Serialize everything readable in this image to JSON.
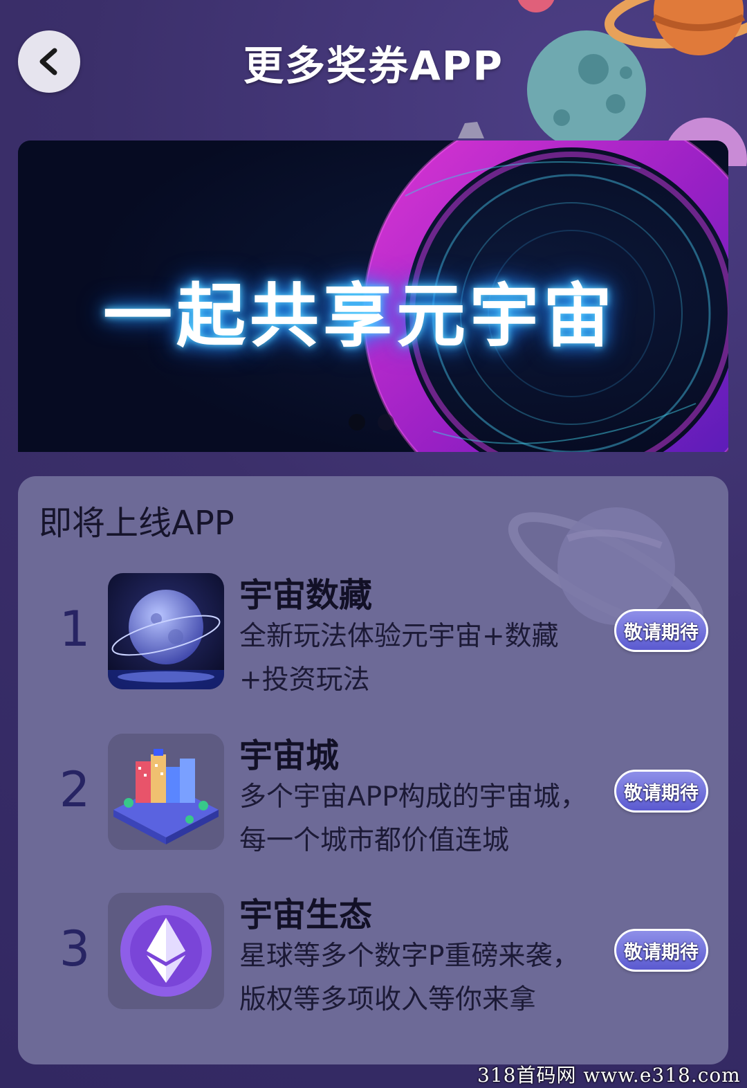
{
  "header": {
    "title": "更多奖券APP",
    "back_icon": "chevron-left-icon"
  },
  "banner": {
    "text": "一起共享元宇宙",
    "active_slide": 1,
    "slide_count": 2
  },
  "upcoming": {
    "title": "即将上线APP",
    "items": [
      {
        "rank": "1",
        "name": "宇宙数藏",
        "desc": "全新玩法体验元宇宙+数藏+投资玩法",
        "status": "敬请期待",
        "icon": "moon-planet-icon"
      },
      {
        "rank": "2",
        "name": "宇宙城",
        "desc": "多个宇宙APP构成的宇宙城，每一个城市都价值连城",
        "status": "敬请期待",
        "icon": "isometric-city-icon"
      },
      {
        "rank": "3",
        "name": "宇宙生态",
        "desc": "星球等多个数字P重磅来袭，版权等多项收入等你来拿",
        "status": "敬请期待",
        "icon": "ethereum-icon"
      }
    ]
  },
  "watermark": "318首码网  www.e318.com",
  "colors": {
    "background": "#3a2f66",
    "card": "#6d6a97",
    "button_gradient_top": "#8e8fe8",
    "button_gradient_bottom": "#5b5ad0",
    "rank_number": "#272463"
  }
}
